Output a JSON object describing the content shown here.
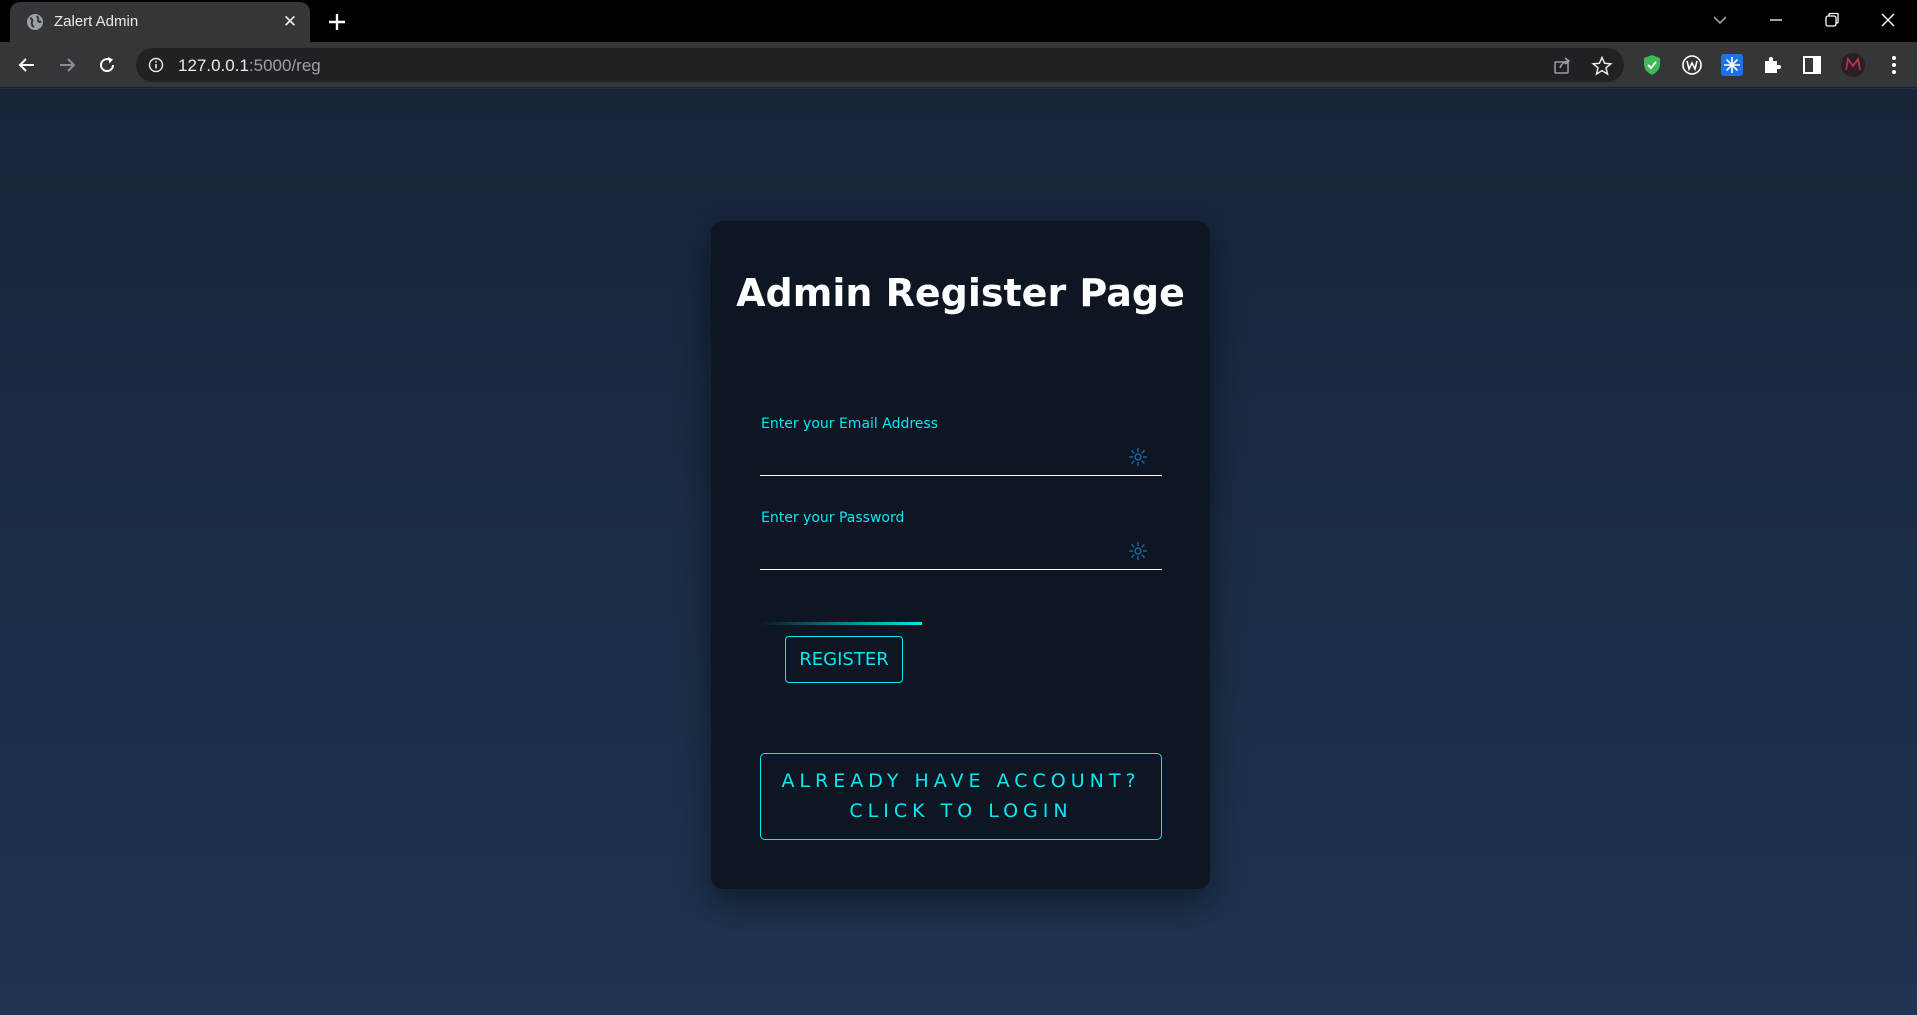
{
  "browser": {
    "tab_title": "Zalert Admin",
    "tab_close": "✕",
    "url_host": "127.0.0.1",
    "url_path": ":5000/reg",
    "icons": [
      "globe-icon",
      "new-tab-icon",
      "tab-search-icon",
      "minimize-icon",
      "restore-icon",
      "close-window-icon",
      "back-icon",
      "forward-icon",
      "reload-icon",
      "site-info-icon",
      "share-icon",
      "bookmark-star-icon",
      "shield-extension-icon",
      "w-extension-icon",
      "snowflake-extension-icon",
      "extensions-puzzle-icon",
      "side-panel-icon",
      "profile-avatar-icon",
      "menu-kebab-icon"
    ]
  },
  "page": {
    "title": "Admin Register Page",
    "email_label": "Enter your Email Address",
    "email_value": "",
    "password_label": "Enter your Password",
    "password_value": "",
    "register_button": "REGISTER",
    "login_line1": "ALREADY HAVE ACCOUNT?",
    "login_line2": "CLICK TO LOGIN"
  },
  "colors": {
    "accent": "#03e9f4",
    "card": "#0d1622",
    "background_top": "#17243a",
    "background_bottom": "#1f3450"
  }
}
